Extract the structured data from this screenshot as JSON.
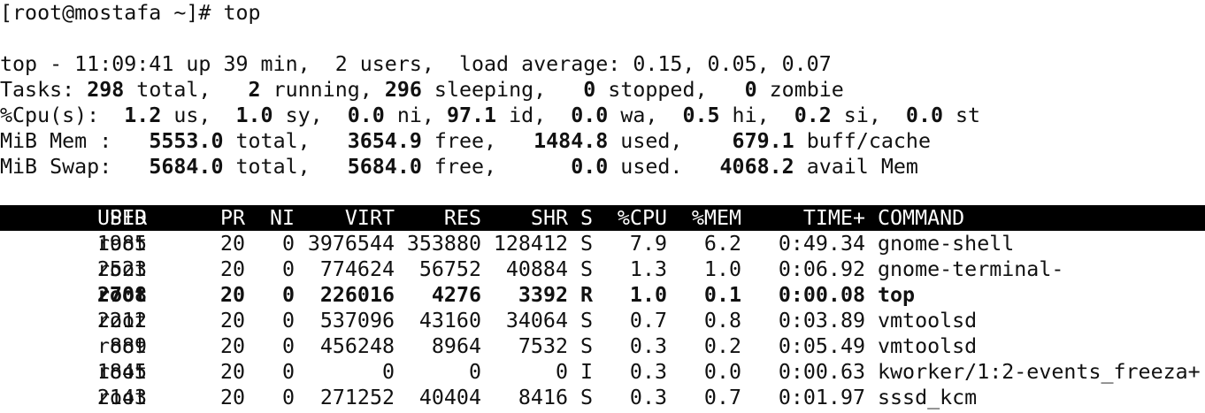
{
  "prompt": {
    "text": "[root@mostafa ~]# top"
  },
  "summary": {
    "line1": "top - 11:09:41 up 39 min,  2 users,  load average: 0.15, 0.05, 0.07",
    "tasks": {
      "label": "Tasks: ",
      "total": "298",
      "total_label": " total,   ",
      "running": "2",
      "running_label": " running, ",
      "sleeping": "296",
      "sleeping_label": " sleeping,   ",
      "stopped": "0",
      "stopped_label": " stopped,   ",
      "zombie": "0",
      "zombie_label": " zombie"
    },
    "cpu": {
      "label": "%Cpu(s):  ",
      "us": "1.2",
      "us_label": " us,  ",
      "sy": "1.0",
      "sy_label": " sy,  ",
      "ni": "0.0",
      "ni_label": " ni, ",
      "id": "97.1",
      "id_label": " id,  ",
      "wa": "0.0",
      "wa_label": " wa,  ",
      "hi": "0.5",
      "hi_label": " hi,  ",
      "si": "0.2",
      "si_label": " si,  ",
      "st": "0.0",
      "st_label": " st"
    },
    "mem": {
      "label": "MiB Mem :   ",
      "total": "5553.0",
      "total_label": " total,   ",
      "free": "3654.9",
      "free_label": " free,   ",
      "used": "1484.8",
      "used_label": " used,    ",
      "cache": "679.1",
      "cache_label": " buff/cache"
    },
    "swap": {
      "label": "MiB Swap:   ",
      "total": "5684.0",
      "total_label": " total,   ",
      "free": "5684.0",
      "free_label": " free,      ",
      "used": "0.0",
      "used_label": " used.   ",
      "avail": "4068.2",
      "avail_label": " avail Mem"
    }
  },
  "table": {
    "headers": {
      "pid": "PID",
      "user": "USER",
      "pr": "PR",
      "ni": "NI",
      "virt": "VIRT",
      "res": "RES",
      "shr": "SHR",
      "s": "S",
      "cpu": "%CPU",
      "mem": "%MEM",
      "time": "TIME+",
      "command": "COMMAND"
    },
    "rows": [
      {
        "pid": "1985",
        "user": "root",
        "pr": "20",
        "ni": "0",
        "virt": "3976544",
        "res": "353880",
        "shr": "128412",
        "s": "S",
        "cpu": "7.9",
        "mem": "6.2",
        "time": "0:49.34",
        "command": "gnome-shell"
      },
      {
        "pid": "2523",
        "user": "root",
        "pr": "20",
        "ni": "0",
        "virt": "774624",
        "res": "56752",
        "shr": "40884",
        "s": "S",
        "cpu": "1.3",
        "mem": "1.0",
        "time": "0:06.92",
        "command": "gnome-terminal-"
      },
      {
        "pid": "2708",
        "user": "root",
        "pr": "20",
        "ni": "0",
        "virt": "226016",
        "res": "4276",
        "shr": "3392",
        "s": "R",
        "cpu": "1.0",
        "mem": "0.1",
        "time": "0:00.08",
        "command": "top"
      },
      {
        "pid": "2212",
        "user": "root",
        "pr": "20",
        "ni": "0",
        "virt": "537096",
        "res": "43160",
        "shr": "34064",
        "s": "S",
        "cpu": "0.7",
        "mem": "0.8",
        "time": "0:03.89",
        "command": "vmtoolsd"
      },
      {
        "pid": "889",
        "user": "root",
        "pr": "20",
        "ni": "0",
        "virt": "456248",
        "res": "8964",
        "shr": "7532",
        "s": "S",
        "cpu": "0.3",
        "mem": "0.2",
        "time": "0:05.49",
        "command": "vmtoolsd"
      },
      {
        "pid": "1845",
        "user": "root",
        "pr": "20",
        "ni": "0",
        "virt": "0",
        "res": "0",
        "shr": "0",
        "s": "I",
        "cpu": "0.3",
        "mem": "0.0",
        "time": "0:00.63",
        "command": "kworker/1:2-events_freeza+"
      },
      {
        "pid": "2143",
        "user": "root",
        "pr": "20",
        "ni": "0",
        "virt": "271252",
        "res": "40404",
        "shr": "8416",
        "s": "S",
        "cpu": "0.3",
        "mem": "0.7",
        "time": "0:01.97",
        "command": "sssd_kcm"
      }
    ]
  },
  "colors": {
    "background": "#ffffff",
    "text": "#111111",
    "header_bg": "#000000",
    "header_text": "#ffffff"
  }
}
